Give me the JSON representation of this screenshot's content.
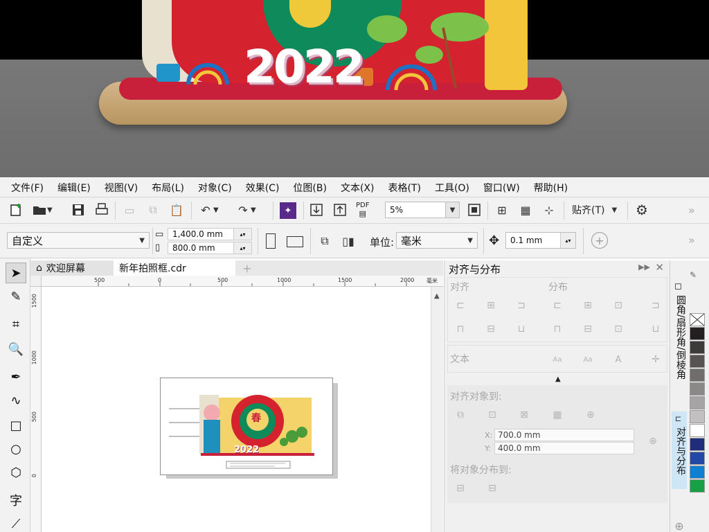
{
  "render": {
    "year_text": "2022",
    "colors": {
      "red": "#d4222f",
      "green": "#0f8a5b",
      "gold": "#f0c93a",
      "wood": "#c9a774",
      "floor": "#767676"
    }
  },
  "menu": [
    "文件(F)",
    "编辑(E)",
    "视图(V)",
    "布局(L)",
    "对象(C)",
    "效果(C)",
    "位图(B)",
    "文本(X)",
    "表格(T)",
    "工具(O)",
    "窗口(W)",
    "帮助(H)"
  ],
  "toolbar": {
    "zoom": "5%",
    "snap_label": "贴齐(T)",
    "pdf_label": "PDF"
  },
  "property_bar": {
    "preset": "自定义",
    "width": "1,400.0 mm",
    "height": "800.0 mm",
    "units_label": "单位:",
    "units": "毫米",
    "nudge": "0.1 mm"
  },
  "tabs": {
    "welcome": "欢迎屏幕",
    "document": "新年拍照框.cdr"
  },
  "ruler": {
    "h_ticks": [
      "500",
      "0",
      "500",
      "1000",
      "1500",
      "2000"
    ],
    "h_unit": "毫米",
    "v_ticks": [
      "1500",
      "1000",
      "500",
      "0"
    ]
  },
  "artwork": {
    "year_text": "2022",
    "glyph": "春"
  },
  "docker": {
    "title": "对齐与分布",
    "align_label": "对齐",
    "distribute_label": "分布",
    "text_label": "文本",
    "align_to_label": "对齐对象到:",
    "x_value": "700.0 mm",
    "y_value": "400.0 mm",
    "distribute_to_label": "将对象分布到:",
    "x_prefix": "X:",
    "y_prefix": "Y:"
  },
  "side_tabs": {
    "corner": "圆角/扇形角/倒棱角",
    "align": "对齐与分布"
  },
  "palette": [
    "#ffffff",
    "#231f20",
    "#3d3a3a",
    "#575353",
    "#716d6d",
    "#8b8888",
    "#a6a4a4",
    "#c2c0c0",
    "#ffffff",
    "#1f2d7a",
    "#2248a5",
    "#0e7fd1",
    "#17a046"
  ]
}
